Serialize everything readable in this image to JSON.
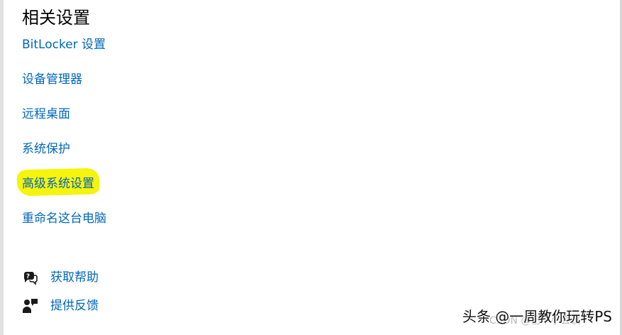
{
  "section": {
    "title": "相关设置"
  },
  "links": [
    {
      "label": "BitLocker 设置"
    },
    {
      "label": "设备管理器"
    },
    {
      "label": "远程桌面"
    },
    {
      "label": "系统保护"
    },
    {
      "label": "高级系统设置"
    },
    {
      "label": "重命名这台电脑"
    }
  ],
  "help": {
    "get_help": {
      "label": "获取帮助",
      "icon": "chat-help-icon"
    },
    "feedback": {
      "label": "提供反馈",
      "icon": "feedback-person-icon"
    }
  },
  "highlight_color": "#f5f200",
  "link_color": "#0067b8",
  "watermark": {
    "text": "头条 @一周教你玩转PS"
  }
}
